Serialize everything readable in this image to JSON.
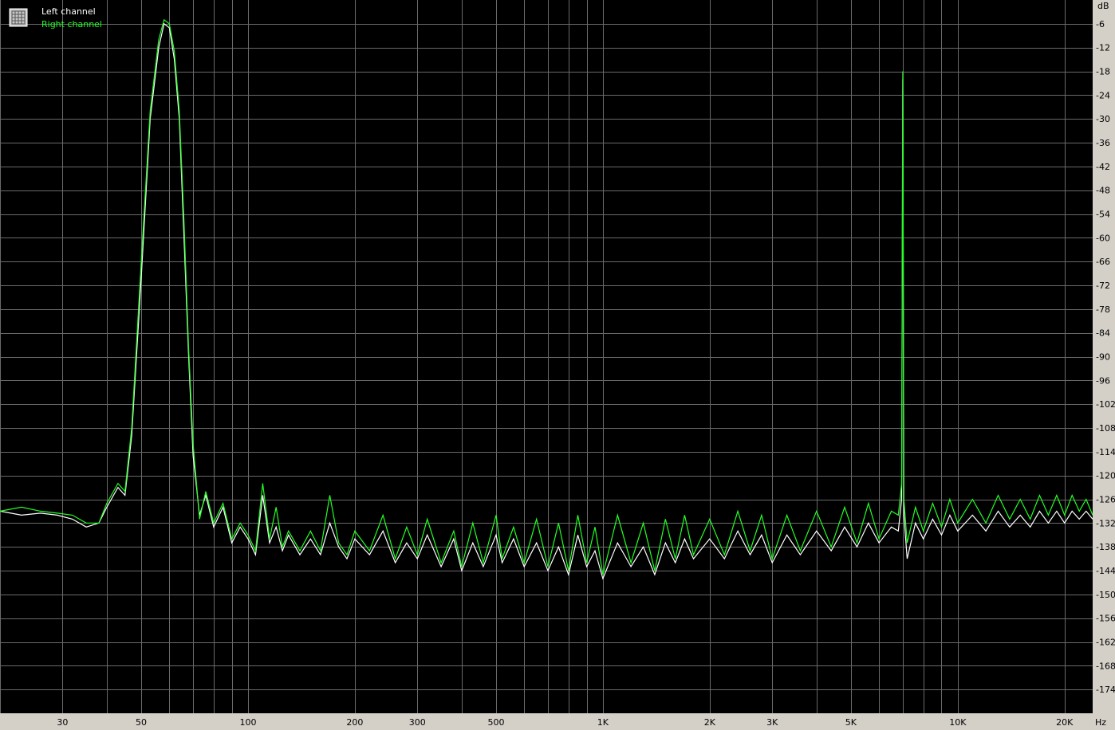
{
  "legend": {
    "left_label": "Left channel",
    "right_label": "Right channel",
    "left_color": "#ffffff",
    "right_color": "#22ff22",
    "icon": "grid-icon"
  },
  "chart_data": {
    "type": "line",
    "x_scale": "log",
    "xlim": [
      20,
      24000
    ],
    "ylim": [
      -180,
      0
    ],
    "y_unit": "dB",
    "x_unit": "Hz",
    "grid": true,
    "legend_position": "top-left",
    "x_ticks": [
      {
        "value": 30,
        "label": "30"
      },
      {
        "value": 50,
        "label": "50"
      },
      {
        "value": 100,
        "label": "100"
      },
      {
        "value": 200,
        "label": "200"
      },
      {
        "value": 300,
        "label": "300"
      },
      {
        "value": 500,
        "label": "500"
      },
      {
        "value": 1000,
        "label": "1K"
      },
      {
        "value": 2000,
        "label": "2K"
      },
      {
        "value": 3000,
        "label": "3K"
      },
      {
        "value": 5000,
        "label": "5K"
      },
      {
        "value": 10000,
        "label": "10K"
      },
      {
        "value": 20000,
        "label": "20K"
      }
    ],
    "y_ticks": [
      -6,
      -12,
      -18,
      -24,
      -30,
      -36,
      -42,
      -48,
      -54,
      -60,
      -66,
      -72,
      -78,
      -84,
      -90,
      -96,
      -102,
      -108,
      -114,
      -120,
      -126,
      -132,
      -138,
      -144,
      -150,
      -156,
      -162,
      -168,
      -174
    ],
    "series": [
      {
        "name": "Left channel",
        "color": "#ffffff",
        "points": [
          [
            20,
            -129
          ],
          [
            23,
            -130
          ],
          [
            26,
            -129.5
          ],
          [
            29,
            -130
          ],
          [
            32,
            -131
          ],
          [
            35,
            -133
          ],
          [
            38,
            -132
          ],
          [
            40,
            -128
          ],
          [
            43,
            -123
          ],
          [
            45,
            -125
          ],
          [
            47,
            -110
          ],
          [
            50,
            -70
          ],
          [
            53,
            -30
          ],
          [
            56,
            -12
          ],
          [
            58,
            -6
          ],
          [
            60,
            -7
          ],
          [
            62,
            -15
          ],
          [
            64,
            -30
          ],
          [
            66,
            -60
          ],
          [
            68,
            -90
          ],
          [
            70,
            -115
          ],
          [
            73,
            -130
          ],
          [
            76,
            -125
          ],
          [
            80,
            -133
          ],
          [
            85,
            -128
          ],
          [
            90,
            -137
          ],
          [
            95,
            -133
          ],
          [
            100,
            -136
          ],
          [
            105,
            -140
          ],
          [
            110,
            -125
          ],
          [
            115,
            -137
          ],
          [
            120,
            -133
          ],
          [
            125,
            -139
          ],
          [
            130,
            -135
          ],
          [
            140,
            -140
          ],
          [
            150,
            -136
          ],
          [
            160,
            -140
          ],
          [
            170,
            -132
          ],
          [
            180,
            -138
          ],
          [
            190,
            -141
          ],
          [
            200,
            -136
          ],
          [
            220,
            -140
          ],
          [
            240,
            -134
          ],
          [
            260,
            -142
          ],
          [
            280,
            -137
          ],
          [
            300,
            -141
          ],
          [
            320,
            -135
          ],
          [
            350,
            -143
          ],
          [
            380,
            -136
          ],
          [
            400,
            -144
          ],
          [
            430,
            -137
          ],
          [
            460,
            -143
          ],
          [
            500,
            -135
          ],
          [
            520,
            -142
          ],
          [
            560,
            -136
          ],
          [
            600,
            -143
          ],
          [
            650,
            -137
          ],
          [
            700,
            -144
          ],
          [
            750,
            -138
          ],
          [
            800,
            -145
          ],
          [
            850,
            -135
          ],
          [
            900,
            -143
          ],
          [
            950,
            -139
          ],
          [
            1000,
            -146
          ],
          [
            1100,
            -137
          ],
          [
            1200,
            -143
          ],
          [
            1300,
            -138
          ],
          [
            1400,
            -145
          ],
          [
            1500,
            -137
          ],
          [
            1600,
            -142
          ],
          [
            1700,
            -136
          ],
          [
            1800,
            -141
          ],
          [
            2000,
            -136
          ],
          [
            2200,
            -141
          ],
          [
            2400,
            -134
          ],
          [
            2600,
            -140
          ],
          [
            2800,
            -135
          ],
          [
            3000,
            -142
          ],
          [
            3300,
            -135
          ],
          [
            3600,
            -140
          ],
          [
            4000,
            -134
          ],
          [
            4400,
            -139
          ],
          [
            4800,
            -133
          ],
          [
            5200,
            -138
          ],
          [
            5600,
            -132
          ],
          [
            6000,
            -137
          ],
          [
            6500,
            -133
          ],
          [
            6800,
            -134
          ],
          [
            6950,
            -126
          ],
          [
            7000,
            -20
          ],
          [
            7050,
            -130
          ],
          [
            7200,
            -141
          ],
          [
            7600,
            -132
          ],
          [
            8000,
            -136
          ],
          [
            8500,
            -131
          ],
          [
            9000,
            -135
          ],
          [
            9500,
            -130
          ],
          [
            10000,
            -134
          ],
          [
            11000,
            -130
          ],
          [
            12000,
            -134
          ],
          [
            13000,
            -129
          ],
          [
            14000,
            -133
          ],
          [
            15000,
            -130
          ],
          [
            16000,
            -133
          ],
          [
            17000,
            -129
          ],
          [
            18000,
            -132
          ],
          [
            19000,
            -129
          ],
          [
            20000,
            -132
          ],
          [
            21000,
            -129
          ],
          [
            22000,
            -131
          ],
          [
            23000,
            -129
          ],
          [
            24000,
            -131
          ]
        ]
      },
      {
        "name": "Right channel",
        "color": "#22ff22",
        "points": [
          [
            20,
            -129
          ],
          [
            23,
            -128
          ],
          [
            26,
            -129
          ],
          [
            29,
            -129.5
          ],
          [
            32,
            -130
          ],
          [
            35,
            -132
          ],
          [
            38,
            -132
          ],
          [
            40,
            -127
          ],
          [
            43,
            -122
          ],
          [
            45,
            -124
          ],
          [
            47,
            -108
          ],
          [
            50,
            -66
          ],
          [
            53,
            -28
          ],
          [
            56,
            -10
          ],
          [
            58,
            -5
          ],
          [
            60,
            -6
          ],
          [
            62,
            -13
          ],
          [
            64,
            -28
          ],
          [
            66,
            -56
          ],
          [
            68,
            -88
          ],
          [
            70,
            -112
          ],
          [
            73,
            -131
          ],
          [
            76,
            -124
          ],
          [
            80,
            -132
          ],
          [
            85,
            -127
          ],
          [
            90,
            -136
          ],
          [
            95,
            -132
          ],
          [
            100,
            -135
          ],
          [
            105,
            -139
          ],
          [
            110,
            -122
          ],
          [
            115,
            -136
          ],
          [
            120,
            -128
          ],
          [
            125,
            -138
          ],
          [
            130,
            -134
          ],
          [
            140,
            -139
          ],
          [
            150,
            -134
          ],
          [
            160,
            -139
          ],
          [
            170,
            -125
          ],
          [
            180,
            -137
          ],
          [
            190,
            -140
          ],
          [
            200,
            -134
          ],
          [
            220,
            -139
          ],
          [
            240,
            -130
          ],
          [
            260,
            -141
          ],
          [
            280,
            -133
          ],
          [
            300,
            -140
          ],
          [
            320,
            -131
          ],
          [
            350,
            -142
          ],
          [
            380,
            -134
          ],
          [
            400,
            -143
          ],
          [
            430,
            -132
          ],
          [
            460,
            -142
          ],
          [
            500,
            -130
          ],
          [
            520,
            -141
          ],
          [
            560,
            -133
          ],
          [
            600,
            -142
          ],
          [
            650,
            -131
          ],
          [
            700,
            -143
          ],
          [
            750,
            -132
          ],
          [
            800,
            -144
          ],
          [
            850,
            -130
          ],
          [
            900,
            -142
          ],
          [
            950,
            -133
          ],
          [
            1000,
            -145
          ],
          [
            1100,
            -130
          ],
          [
            1200,
            -142
          ],
          [
            1300,
            -132
          ],
          [
            1400,
            -144
          ],
          [
            1500,
            -131
          ],
          [
            1600,
            -141
          ],
          [
            1700,
            -130
          ],
          [
            1800,
            -140
          ],
          [
            2000,
            -131
          ],
          [
            2200,
            -140
          ],
          [
            2400,
            -129
          ],
          [
            2600,
            -139
          ],
          [
            2800,
            -130
          ],
          [
            3000,
            -141
          ],
          [
            3300,
            -130
          ],
          [
            3600,
            -139
          ],
          [
            4000,
            -129
          ],
          [
            4400,
            -138
          ],
          [
            4800,
            -128
          ],
          [
            5200,
            -137
          ],
          [
            5600,
            -127
          ],
          [
            6000,
            -136
          ],
          [
            6500,
            -129
          ],
          [
            6800,
            -130
          ],
          [
            6950,
            -122
          ],
          [
            7000,
            -18
          ],
          [
            7050,
            -126
          ],
          [
            7200,
            -137
          ],
          [
            7600,
            -128
          ],
          [
            8000,
            -134
          ],
          [
            8500,
            -127
          ],
          [
            9000,
            -133
          ],
          [
            9500,
            -126
          ],
          [
            10000,
            -132
          ],
          [
            11000,
            -126
          ],
          [
            12000,
            -132
          ],
          [
            13000,
            -125
          ],
          [
            14000,
            -131
          ],
          [
            15000,
            -126
          ],
          [
            16000,
            -131
          ],
          [
            17000,
            -125
          ],
          [
            18000,
            -130
          ],
          [
            19000,
            -125
          ],
          [
            20000,
            -130
          ],
          [
            21000,
            -125
          ],
          [
            22000,
            -129
          ],
          [
            23000,
            -126
          ],
          [
            24000,
            -130
          ]
        ]
      }
    ]
  }
}
